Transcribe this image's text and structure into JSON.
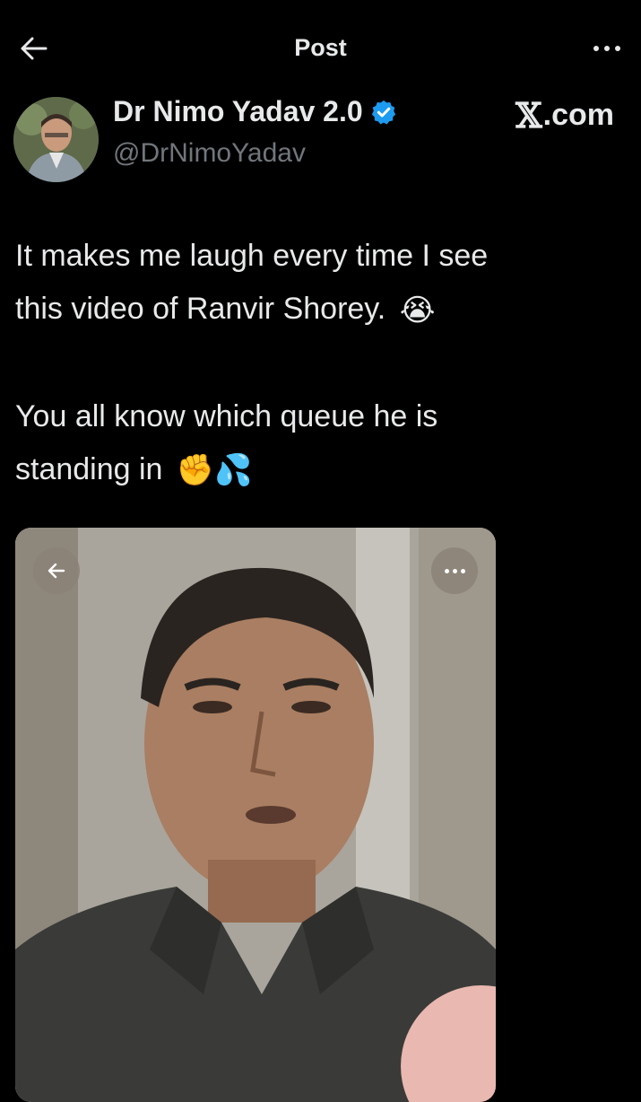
{
  "header": {
    "title": "Post",
    "back_icon": "arrow-left-icon",
    "more_icon": "more-horizontal-icon"
  },
  "author": {
    "display_name": "Dr Nimo Yadav 2.0",
    "handle": "@DrNimoYadav",
    "verified_color": "#1d9bf0",
    "source_label": ".com",
    "source_logo": "𝕏"
  },
  "tweet": {
    "line1": "It makes me laugh every time I see",
    "line2": "this video of Ranvir Shorey.",
    "line2_emoji": "😭",
    "line3": "You all know which queue he is",
    "line4": "standing in",
    "line4_emojis": "✊💦"
  },
  "media": {
    "back_icon": "arrow-left-icon",
    "more_icon": "more-horizontal-icon"
  },
  "colors": {
    "background": "#000000",
    "text_primary": "#e7e9ea",
    "text_secondary": "#71767b",
    "accent": "#1d9bf0"
  }
}
